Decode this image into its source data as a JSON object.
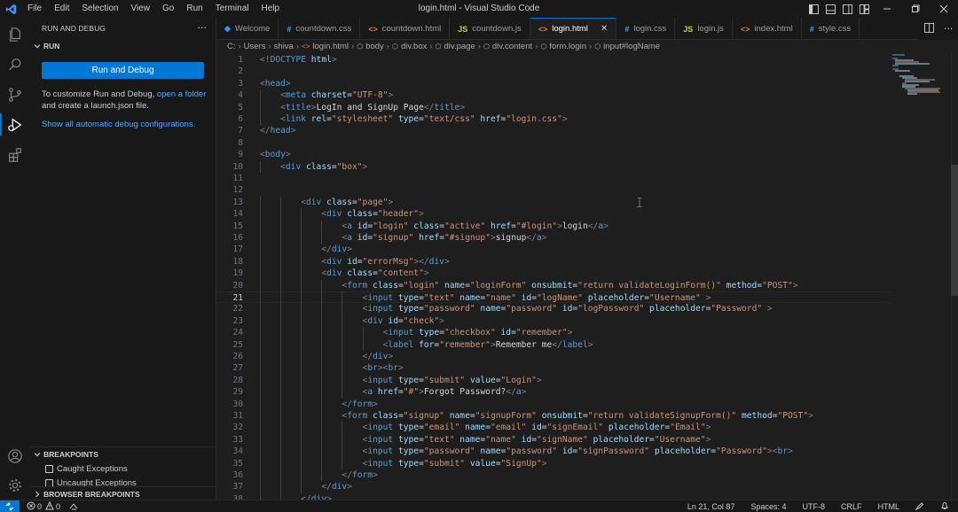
{
  "menu": [
    "File",
    "Edit",
    "Selection",
    "View",
    "Go",
    "Run",
    "Terminal",
    "Help"
  ],
  "window_title": "login.html - Visual Studio Code",
  "sidebar": {
    "header": "RUN AND DEBUG",
    "more": "···",
    "run_section": "RUN",
    "run_button": "Run and Debug",
    "info_text_1": "To customize Run and Debug, ",
    "info_link": "open a folder",
    "info_text_2": " and create a launch.json file.",
    "show_all": "Show all automatic debug configurations.",
    "breakpoints_title": "BREAKPOINTS",
    "breakpoints": [
      "Caught Exceptions",
      "Uncaught Exceptions"
    ],
    "browser_breakpoints": "BROWSER BREAKPOINTS"
  },
  "tabs": [
    {
      "label": "Welcome",
      "icon": "vscode-icon",
      "icon_text": "◆",
      "color": "#3794ff"
    },
    {
      "label": "countdown.css",
      "icon": "css-icon",
      "icon_text": "#",
      "color": "#42a5f5"
    },
    {
      "label": "countdown.html",
      "icon": "html-icon",
      "icon_text": "<>",
      "color": "#e37933"
    },
    {
      "label": "countdown.js",
      "icon": "js-icon",
      "icon_text": "JS",
      "color": "#cbcb41"
    },
    {
      "label": "login.html",
      "icon": "html-icon",
      "icon_text": "<>",
      "color": "#e37933",
      "active": true,
      "close": "✕"
    },
    {
      "label": "login.css",
      "icon": "css-icon",
      "icon_text": "#",
      "color": "#42a5f5"
    },
    {
      "label": "login.js",
      "icon": "js-icon",
      "icon_text": "JS",
      "color": "#cbcb41"
    },
    {
      "label": "index.html",
      "icon": "html-icon",
      "icon_text": "<>",
      "color": "#e37933"
    },
    {
      "label": "style.css",
      "icon": "css-icon",
      "icon_text": "#",
      "color": "#42a5f5"
    }
  ],
  "breadcrumb": [
    "C:",
    "Users",
    "shiva",
    "login.html",
    "body",
    "div.box",
    "div.page",
    "div.content",
    "form.login",
    "input#logName"
  ],
  "code_lines": [
    [
      [
        "b",
        "<!"
      ],
      [
        "d",
        "DOCTYPE"
      ],
      [
        "a",
        " html"
      ],
      [
        "b",
        ">"
      ]
    ],
    [],
    [
      [
        "b",
        "<"
      ],
      [
        "t",
        "head"
      ],
      [
        "b",
        ">"
      ]
    ],
    [
      [
        "x",
        "    "
      ],
      [
        "b",
        "<"
      ],
      [
        "t",
        "meta"
      ],
      [
        "a",
        " charset"
      ],
      [
        "x",
        "="
      ],
      [
        "s",
        "\"UTF-8\""
      ],
      [
        "b",
        ">"
      ]
    ],
    [
      [
        "x",
        "    "
      ],
      [
        "b",
        "<"
      ],
      [
        "t",
        "title"
      ],
      [
        "b",
        ">"
      ],
      [
        "x",
        "LogIn and SignUp Page"
      ],
      [
        "b",
        "</"
      ],
      [
        "t",
        "title"
      ],
      [
        "b",
        ">"
      ]
    ],
    [
      [
        "x",
        "    "
      ],
      [
        "b",
        "<"
      ],
      [
        "t",
        "link"
      ],
      [
        "a",
        " rel"
      ],
      [
        "x",
        "="
      ],
      [
        "s",
        "\"stylesheet\""
      ],
      [
        "a",
        " type"
      ],
      [
        "x",
        "="
      ],
      [
        "s",
        "\"text/css\""
      ],
      [
        "a",
        " href"
      ],
      [
        "x",
        "="
      ],
      [
        "s",
        "\"login.css\""
      ],
      [
        "b",
        ">"
      ]
    ],
    [
      [
        "b",
        "</"
      ],
      [
        "t",
        "head"
      ],
      [
        "b",
        ">"
      ]
    ],
    [],
    [
      [
        "b",
        "<"
      ],
      [
        "t",
        "body"
      ],
      [
        "b",
        ">"
      ]
    ],
    [
      [
        "x",
        "    "
      ],
      [
        "b",
        "<"
      ],
      [
        "t",
        "div"
      ],
      [
        "a",
        " class"
      ],
      [
        "x",
        "="
      ],
      [
        "s",
        "\"box\""
      ],
      [
        "b",
        ">"
      ]
    ],
    [],
    [],
    [
      [
        "x",
        "        "
      ],
      [
        "b",
        "<"
      ],
      [
        "t",
        "div"
      ],
      [
        "a",
        " class"
      ],
      [
        "x",
        "="
      ],
      [
        "s",
        "\"page\""
      ],
      [
        "b",
        ">"
      ]
    ],
    [
      [
        "x",
        "            "
      ],
      [
        "b",
        "<"
      ],
      [
        "t",
        "div"
      ],
      [
        "a",
        " class"
      ],
      [
        "x",
        "="
      ],
      [
        "s",
        "\"header\""
      ],
      [
        "b",
        ">"
      ]
    ],
    [
      [
        "x",
        "                "
      ],
      [
        "b",
        "<"
      ],
      [
        "t",
        "a"
      ],
      [
        "a",
        " id"
      ],
      [
        "x",
        "="
      ],
      [
        "s",
        "\"login\""
      ],
      [
        "a",
        " class"
      ],
      [
        "x",
        "="
      ],
      [
        "s",
        "\"active\""
      ],
      [
        "a",
        " href"
      ],
      [
        "x",
        "="
      ],
      [
        "s",
        "\"#login\""
      ],
      [
        "b",
        ">"
      ],
      [
        "x",
        "login"
      ],
      [
        "b",
        "</"
      ],
      [
        "t",
        "a"
      ],
      [
        "b",
        ">"
      ]
    ],
    [
      [
        "x",
        "                "
      ],
      [
        "b",
        "<"
      ],
      [
        "t",
        "a"
      ],
      [
        "a",
        " id"
      ],
      [
        "x",
        "="
      ],
      [
        "s",
        "\"signup\""
      ],
      [
        "a",
        " href"
      ],
      [
        "x",
        "="
      ],
      [
        "s",
        "\"#signup\""
      ],
      [
        "b",
        ">"
      ],
      [
        "x",
        "signup"
      ],
      [
        "b",
        "</"
      ],
      [
        "t",
        "a"
      ],
      [
        "b",
        ">"
      ]
    ],
    [
      [
        "x",
        "            "
      ],
      [
        "b",
        "</"
      ],
      [
        "t",
        "div"
      ],
      [
        "b",
        ">"
      ]
    ],
    [
      [
        "x",
        "            "
      ],
      [
        "b",
        "<"
      ],
      [
        "t",
        "div"
      ],
      [
        "a",
        " id"
      ],
      [
        "x",
        "="
      ],
      [
        "s",
        "\"errorMsg\""
      ],
      [
        "b",
        "></"
      ],
      [
        "t",
        "div"
      ],
      [
        "b",
        ">"
      ]
    ],
    [
      [
        "x",
        "            "
      ],
      [
        "b",
        "<"
      ],
      [
        "t",
        "div"
      ],
      [
        "a",
        " class"
      ],
      [
        "x",
        "="
      ],
      [
        "s",
        "\"content\""
      ],
      [
        "b",
        ">"
      ]
    ],
    [
      [
        "x",
        "                "
      ],
      [
        "b",
        "<"
      ],
      [
        "t",
        "form"
      ],
      [
        "a",
        " class"
      ],
      [
        "x",
        "="
      ],
      [
        "s",
        "\"login\""
      ],
      [
        "a",
        " name"
      ],
      [
        "x",
        "="
      ],
      [
        "s",
        "\"loginForm\""
      ],
      [
        "a",
        " onsubmit"
      ],
      [
        "x",
        "="
      ],
      [
        "s",
        "\"return validateLoginForm()\""
      ],
      [
        "a",
        " method"
      ],
      [
        "x",
        "="
      ],
      [
        "s",
        "\"POST\""
      ],
      [
        "b",
        ">"
      ]
    ],
    [
      [
        "x",
        "                    "
      ],
      [
        "b",
        "<"
      ],
      [
        "t",
        "input"
      ],
      [
        "a",
        " type"
      ],
      [
        "x",
        "="
      ],
      [
        "s",
        "\"text\""
      ],
      [
        "a",
        " name"
      ],
      [
        "x",
        "="
      ],
      [
        "s",
        "\"name\""
      ],
      [
        "a",
        " id"
      ],
      [
        "x",
        "="
      ],
      [
        "s",
        "\"logName\""
      ],
      [
        "a",
        " placeholder"
      ],
      [
        "x",
        "="
      ],
      [
        "s",
        "\"Username\""
      ],
      [
        "x",
        " "
      ],
      [
        "b",
        ">"
      ]
    ],
    [
      [
        "x",
        "                    "
      ],
      [
        "b",
        "<"
      ],
      [
        "t",
        "input"
      ],
      [
        "a",
        " type"
      ],
      [
        "x",
        "="
      ],
      [
        "s",
        "\"password\""
      ],
      [
        "a",
        " name"
      ],
      [
        "x",
        "="
      ],
      [
        "s",
        "\"password\""
      ],
      [
        "a",
        " id"
      ],
      [
        "x",
        "="
      ],
      [
        "s",
        "\"logPassword\""
      ],
      [
        "a",
        " placeholder"
      ],
      [
        "x",
        "="
      ],
      [
        "s",
        "\"Password\""
      ],
      [
        "x",
        " "
      ],
      [
        "b",
        ">"
      ]
    ],
    [
      [
        "x",
        "                    "
      ],
      [
        "b",
        "<"
      ],
      [
        "t",
        "div"
      ],
      [
        "a",
        " id"
      ],
      [
        "x",
        "="
      ],
      [
        "s",
        "\"check\""
      ],
      [
        "b",
        ">"
      ]
    ],
    [
      [
        "x",
        "                        "
      ],
      [
        "b",
        "<"
      ],
      [
        "t",
        "input"
      ],
      [
        "a",
        " type"
      ],
      [
        "x",
        "="
      ],
      [
        "s",
        "\"checkbox\""
      ],
      [
        "a",
        " id"
      ],
      [
        "x",
        "="
      ],
      [
        "s",
        "\"remember\""
      ],
      [
        "b",
        ">"
      ]
    ],
    [
      [
        "x",
        "                        "
      ],
      [
        "b",
        "<"
      ],
      [
        "t",
        "label"
      ],
      [
        "a",
        " for"
      ],
      [
        "x",
        "="
      ],
      [
        "s",
        "\"remember\""
      ],
      [
        "b",
        ">"
      ],
      [
        "x",
        "Remember me"
      ],
      [
        "b",
        "</"
      ],
      [
        "t",
        "label"
      ],
      [
        "b",
        ">"
      ]
    ],
    [
      [
        "x",
        "                    "
      ],
      [
        "b",
        "</"
      ],
      [
        "t",
        "div"
      ],
      [
        "b",
        ">"
      ]
    ],
    [
      [
        "x",
        "                    "
      ],
      [
        "b",
        "<"
      ],
      [
        "t",
        "br"
      ],
      [
        "b",
        "><"
      ],
      [
        "t",
        "br"
      ],
      [
        "b",
        ">"
      ]
    ],
    [
      [
        "x",
        "                    "
      ],
      [
        "b",
        "<"
      ],
      [
        "t",
        "input"
      ],
      [
        "a",
        " type"
      ],
      [
        "x",
        "="
      ],
      [
        "s",
        "\"submit\""
      ],
      [
        "a",
        " value"
      ],
      [
        "x",
        "="
      ],
      [
        "s",
        "\"Login\""
      ],
      [
        "b",
        ">"
      ]
    ],
    [
      [
        "x",
        "                    "
      ],
      [
        "b",
        "<"
      ],
      [
        "t",
        "a"
      ],
      [
        "a",
        " href"
      ],
      [
        "x",
        "="
      ],
      [
        "s",
        "\"#\""
      ],
      [
        "b",
        ">"
      ],
      [
        "x",
        "Forgot Password?"
      ],
      [
        "b",
        "</"
      ],
      [
        "t",
        "a"
      ],
      [
        "b",
        ">"
      ]
    ],
    [
      [
        "x",
        "                "
      ],
      [
        "b",
        "</"
      ],
      [
        "t",
        "form"
      ],
      [
        "b",
        ">"
      ]
    ],
    [
      [
        "x",
        "                "
      ],
      [
        "b",
        "<"
      ],
      [
        "t",
        "form"
      ],
      [
        "a",
        " class"
      ],
      [
        "x",
        "="
      ],
      [
        "s",
        "\"signup\""
      ],
      [
        "a",
        " name"
      ],
      [
        "x",
        "="
      ],
      [
        "s",
        "\"signupForm\""
      ],
      [
        "a",
        " onsubmit"
      ],
      [
        "x",
        "="
      ],
      [
        "s",
        "\"return validateSignupForm()\""
      ],
      [
        "a",
        " method"
      ],
      [
        "x",
        "="
      ],
      [
        "s",
        "\"POST\""
      ],
      [
        "b",
        ">"
      ]
    ],
    [
      [
        "x",
        "                    "
      ],
      [
        "b",
        "<"
      ],
      [
        "t",
        "input"
      ],
      [
        "a",
        " type"
      ],
      [
        "x",
        "="
      ],
      [
        "s",
        "\"email\""
      ],
      [
        "a",
        " name"
      ],
      [
        "x",
        "="
      ],
      [
        "s",
        "\"email\""
      ],
      [
        "a",
        " id"
      ],
      [
        "x",
        "="
      ],
      [
        "s",
        "\"signEmail\""
      ],
      [
        "a",
        " placeholder"
      ],
      [
        "x",
        "="
      ],
      [
        "s",
        "\"Email\""
      ],
      [
        "b",
        ">"
      ]
    ],
    [
      [
        "x",
        "                    "
      ],
      [
        "b",
        "<"
      ],
      [
        "t",
        "input"
      ],
      [
        "a",
        " type"
      ],
      [
        "x",
        "="
      ],
      [
        "s",
        "\"text\""
      ],
      [
        "a",
        " name"
      ],
      [
        "x",
        "="
      ],
      [
        "s",
        "\"name\""
      ],
      [
        "a",
        " id"
      ],
      [
        "x",
        "="
      ],
      [
        "s",
        "\"signName\""
      ],
      [
        "a",
        " placeholder"
      ],
      [
        "x",
        "="
      ],
      [
        "s",
        "\"Username\""
      ],
      [
        "b",
        ">"
      ]
    ],
    [
      [
        "x",
        "                    "
      ],
      [
        "b",
        "<"
      ],
      [
        "t",
        "input"
      ],
      [
        "a",
        " type"
      ],
      [
        "x",
        "="
      ],
      [
        "s",
        "\"password\""
      ],
      [
        "a",
        " name"
      ],
      [
        "x",
        "="
      ],
      [
        "s",
        "\"password\""
      ],
      [
        "a",
        " id"
      ],
      [
        "x",
        "="
      ],
      [
        "s",
        "\"signPassword\""
      ],
      [
        "a",
        " placeholder"
      ],
      [
        "x",
        "="
      ],
      [
        "s",
        "\"Password\""
      ],
      [
        "b",
        "><"
      ],
      [
        "t",
        "br"
      ],
      [
        "b",
        ">"
      ]
    ],
    [
      [
        "x",
        "                    "
      ],
      [
        "b",
        "<"
      ],
      [
        "t",
        "input"
      ],
      [
        "a",
        " type"
      ],
      [
        "x",
        "="
      ],
      [
        "s",
        "\"submit\""
      ],
      [
        "a",
        " value"
      ],
      [
        "x",
        "="
      ],
      [
        "s",
        "\"SignUp\""
      ],
      [
        "b",
        ">"
      ]
    ],
    [
      [
        "x",
        "                "
      ],
      [
        "b",
        "</"
      ],
      [
        "t",
        "form"
      ],
      [
        "b",
        ">"
      ]
    ],
    [
      [
        "x",
        "            "
      ],
      [
        "b",
        "</"
      ],
      [
        "t",
        "div"
      ],
      [
        "b",
        ">"
      ]
    ],
    [
      [
        "x",
        "        "
      ],
      [
        "b",
        "</"
      ],
      [
        "t",
        "div"
      ],
      [
        "b",
        ">"
      ]
    ]
  ],
  "current_line": 21,
  "status": {
    "errors": "0",
    "warnings": "0",
    "position": "Ln 21, Col 87",
    "spaces": "Spaces: 4",
    "encoding": "UTF-8",
    "eol": "CRLF",
    "language": "HTML"
  },
  "colors": {
    "accent": "#0078d4",
    "tag": "#569cd6",
    "attr": "#9cdcfe",
    "string": "#ce9178",
    "text": "#d4d4d4"
  }
}
